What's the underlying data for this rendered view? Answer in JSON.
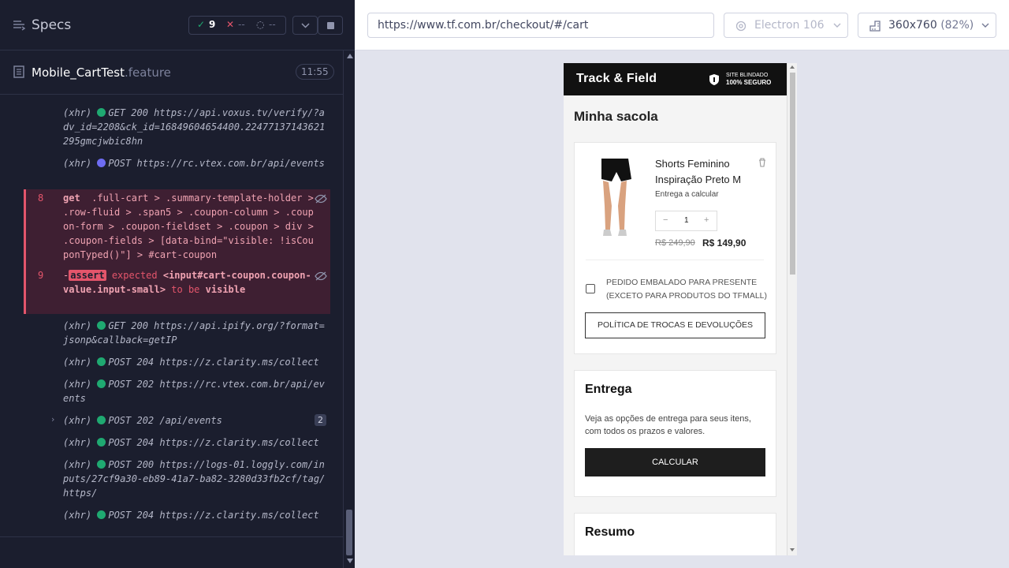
{
  "runner": {
    "title": "Specs",
    "stats": {
      "passed": "9",
      "failed": "--",
      "pending": "--"
    },
    "spec_file": {
      "name": "Mobile_CartTest",
      "ext": ".feature",
      "duration": "11:55"
    },
    "log": [
      {
        "type": "(xhr)",
        "status_color": "#1fa971",
        "text": "GET 200 https://api.voxus.tv/verify/?adv_id=2208&ck_id=16849604654400.22477137143621295gmcjwbic8hn"
      },
      {
        "type": "(xhr)",
        "status_color": "#6e6cf2",
        "text": "POST https://rc.vtex.com.br/api/events"
      },
      {
        "type": "(xhr)",
        "status_color": "#1fa971",
        "text": "GET 200 https://api.ipify.org/?format=jsonp&callback=getIP"
      },
      {
        "type": "(xhr)",
        "status_color": "#1fa971",
        "text": "POST 204 https://z.clarity.ms/collect"
      },
      {
        "type": "(xhr)",
        "status_color": "#1fa971",
        "text": "POST 202 https://rc.vtex.com.br/api/events"
      },
      {
        "type": "(xhr)",
        "status_color": "#1fa971",
        "text": "POST 202 /api/events",
        "count": "2"
      },
      {
        "type": "(xhr)",
        "status_color": "#1fa971",
        "text": "POST 204 https://z.clarity.ms/collect"
      },
      {
        "type": "(xhr)",
        "status_color": "#1fa971",
        "text": "POST 200 https://logs-01.loggly.com/inputs/27cf9a30-eb89-41a7-ba82-3280d33fb2cf/tag/https/"
      },
      {
        "type": "(xhr)",
        "status_color": "#1fa971",
        "text": "POST 204 https://z.clarity.ms/collect"
      }
    ],
    "failed_cmds": {
      "get": {
        "num": "8",
        "cmd": "get",
        "selector": ".full-cart > .summary-template-holder > .row-fluid > .span5 > .coupon-column > .coupon-form > .coupon-fieldset > .coupon > div > .coupon-fields > [data-bind=\"visible: !isCouponTyped()\"] > #cart-coupon"
      },
      "assert": {
        "num": "9",
        "prefix": "-",
        "badge": "assert",
        "kw1": "expected",
        "subject": "<input#cart-coupon.coupon-value.input-small>",
        "kw2": "to be",
        "kw3": "visible"
      }
    }
  },
  "aut_bar": {
    "url": "https://www.tf.com.br/checkout/#/cart",
    "browser": "Electron 106",
    "viewport": "360x760",
    "scale": "(82%)"
  },
  "site": {
    "logo": "Track & Field",
    "secure_line1": "SITE BLINDADO",
    "secure_line2": "100% SEGURO",
    "cart_title": "Minha sacola",
    "product": {
      "name": "Shorts Feminino Inspiração Preto M",
      "delivery": "Entrega a calcular",
      "qty": "1",
      "minus": "−",
      "plus": "+",
      "old_price": "R$ 249,90",
      "price": "R$ 149,90"
    },
    "gift_label": "PEDIDO EMBALADO PARA PRESENTE (EXCETO PARA PRODUTOS DO TFMALL)",
    "policy_button": "POLÍTICA DE TROCAS E DEVOLUÇÕES",
    "delivery_section": {
      "title": "Entrega",
      "text": "Veja as opções de entrega para seus itens, com todos os prazos e valores.",
      "button": "CALCULAR"
    },
    "summary_title": "Resumo"
  }
}
